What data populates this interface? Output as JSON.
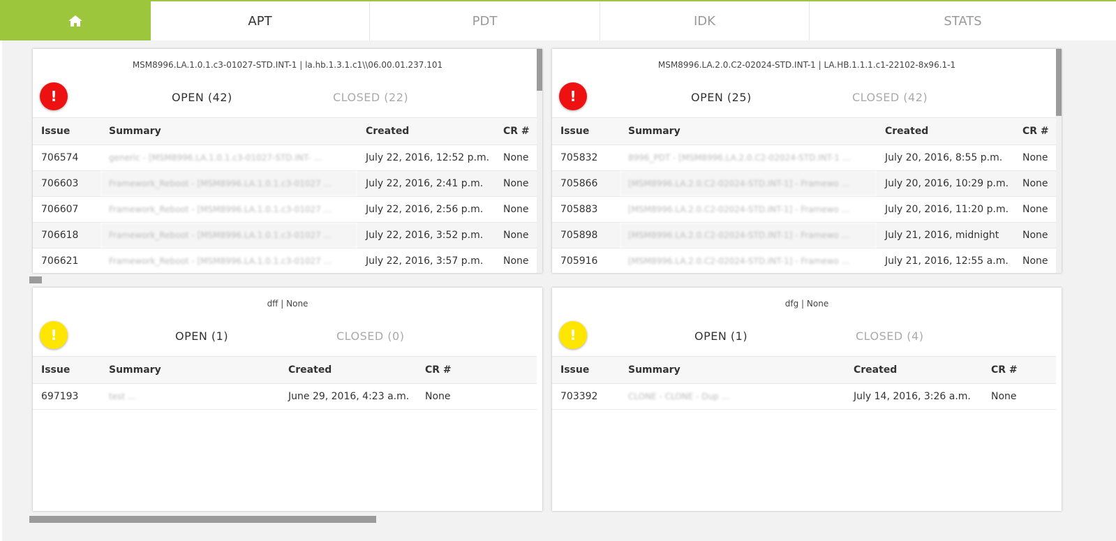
{
  "nav": {
    "home_icon": "home-icon",
    "tabs": [
      {
        "label": "APT",
        "active": true
      },
      {
        "label": "PDT",
        "active": false
      },
      {
        "label": "IDK",
        "active": false
      },
      {
        "label": "STATS",
        "active": false
      }
    ]
  },
  "colors": {
    "accent": "#9cc63b",
    "alert_red": "#ee1111",
    "alert_yellow": "#ffe600"
  },
  "columns": [
    "Issue",
    "Summary",
    "Created",
    "CR #"
  ],
  "panels": [
    {
      "title": "MSM8996.LA.1.0.1.c3-01027-STD.INT-1 | la.hb.1.3.1.c1\\\\06.00.01.237.101",
      "alert_icon": "exclamation-icon",
      "alert_level": "red",
      "open_label": "OPEN (42)",
      "closed_label": "CLOSED (22)",
      "rows": [
        {
          "issue": "706574",
          "summary": "generic - [MSM8996.LA.1.0.1.c3-01027-STD.INT- ...",
          "created": "July 22, 2016, 12:52 p.m.",
          "cr": "None"
        },
        {
          "issue": "706603",
          "summary": "Framework_Reboot - [MSM8996.LA.1.0.1.c3-01027 ...",
          "created": "July 22, 2016, 2:41 p.m.",
          "cr": "None"
        },
        {
          "issue": "706607",
          "summary": "Framework_Reboot - [MSM8996.LA.1.0.1.c3-01027 ...",
          "created": "July 22, 2016, 2:56 p.m.",
          "cr": "None"
        },
        {
          "issue": "706618",
          "summary": "Framework_Reboot - [MSM8996.LA.1.0.1.c3-01027 ...",
          "created": "July 22, 2016, 3:52 p.m.",
          "cr": "None"
        },
        {
          "issue": "706621",
          "summary": "Framework_Reboot - [MSM8996.LA.1.0.1.c3-01027 ...",
          "created": "July 22, 2016, 3:57 p.m.",
          "cr": "None"
        }
      ]
    },
    {
      "title": "MSM8996.LA.2.0.C2-02024-STD.INT-1 | LA.HB.1.1.1.c1-22102-8x96.1-1",
      "alert_icon": "exclamation-icon",
      "alert_level": "red",
      "open_label": "OPEN (25)",
      "closed_label": "CLOSED (42)",
      "rows": [
        {
          "issue": "705832",
          "summary": "8996_PDT - [MSM8996.LA.2.0.C2-02024-STD.INT-1 ...",
          "created": "July 20, 2016, 8:55 p.m.",
          "cr": "None"
        },
        {
          "issue": "705866",
          "summary": "[MSM8996.LA.2.0.C2-02024-STD.INT-1] - Framewo ...",
          "created": "July 20, 2016, 10:29 p.m.",
          "cr": "None"
        },
        {
          "issue": "705883",
          "summary": "[MSM8996.LA.2.0.C2-02024-STD.INT-1] - Framewo ...",
          "created": "July 20, 2016, 11:20 p.m.",
          "cr": "None"
        },
        {
          "issue": "705898",
          "summary": "[MSM8996.LA.2.0.C2-02024-STD.INT-1] - Framewo ...",
          "created": "July 21, 2016, midnight",
          "cr": "None"
        },
        {
          "issue": "705916",
          "summary": "[MSM8996.LA.2.0.C2-02024-STD.INT-1] - Framewo ...",
          "created": "July 21, 2016, 12:55 a.m.",
          "cr": "None"
        }
      ]
    },
    {
      "title": "dff | None",
      "alert_icon": "exclamation-icon",
      "alert_level": "yellow",
      "open_label": "OPEN (1)",
      "closed_label": "CLOSED (0)",
      "rows": [
        {
          "issue": "697193",
          "summary": "test ...",
          "created": "June 29, 2016, 4:23 a.m.",
          "cr": "None"
        }
      ]
    },
    {
      "title": "dfg | None",
      "alert_icon": "exclamation-icon",
      "alert_level": "yellow",
      "open_label": "OPEN (1)",
      "closed_label": "CLOSED (4)",
      "rows": [
        {
          "issue": "703392",
          "summary": "CLONE - CLONE - Dup ...",
          "created": "July 14, 2016, 3:26 a.m.",
          "cr": "None"
        }
      ]
    }
  ]
}
